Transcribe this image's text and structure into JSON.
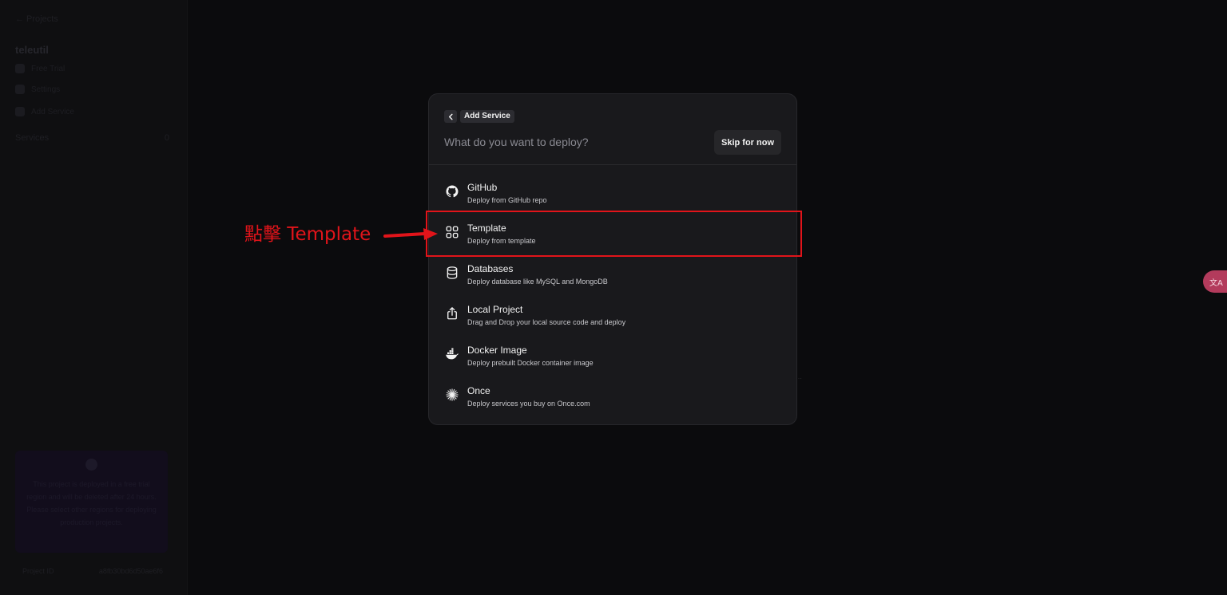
{
  "sidebar": {
    "back_label": "← Projects",
    "project_name": "teleutil",
    "items": [
      {
        "label": "Free Trial"
      },
      {
        "label": "Settings"
      },
      {
        "label": "Add Service"
      }
    ],
    "services_label": "Services",
    "services_count": "0",
    "promo_text": "This project is deployed in a free trial region and will be deleted after 24 hours. Please select other regions for deploying production projects.",
    "footer_label": "Project ID",
    "footer_value": "a8fb30bd6d50ae6f6"
  },
  "modal": {
    "back_icon": "chevron-left-icon",
    "breadcrumb": "Add Service",
    "search_placeholder": "What do you want to deploy?",
    "skip_label": "Skip for now",
    "options": [
      {
        "title": "GitHub",
        "desc": "Deploy from GitHub repo",
        "icon": "github-icon"
      },
      {
        "title": "Template",
        "desc": "Deploy from template",
        "icon": "template-icon"
      },
      {
        "title": "Databases",
        "desc": "Deploy database like MySQL and MongoDB",
        "icon": "database-icon"
      },
      {
        "title": "Local Project",
        "desc": "Drag and Drop your local source code and deploy",
        "icon": "upload-icon"
      },
      {
        "title": "Docker Image",
        "desc": "Deploy prebuilt Docker container image",
        "icon": "docker-icon"
      },
      {
        "title": "Once",
        "desc": "Deploy services you buy on Once.com",
        "icon": "once-icon"
      }
    ]
  },
  "annotation": {
    "text": "點擊 Template",
    "color": "#e1141a"
  },
  "translate_badge": "文A"
}
